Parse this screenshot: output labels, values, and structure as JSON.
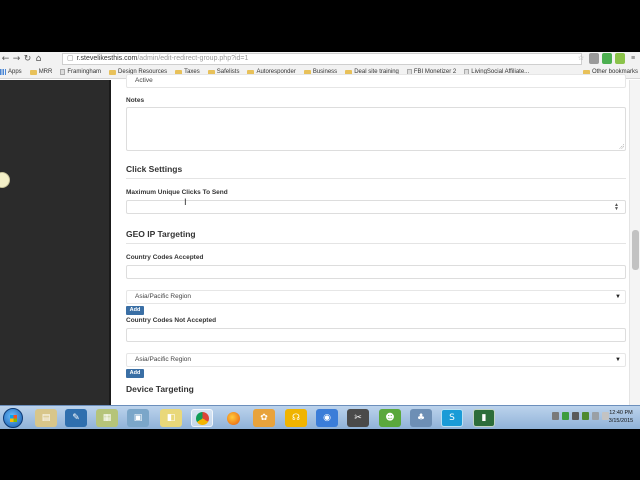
{
  "browser": {
    "url_domain": "r.stevelikesthis.com",
    "url_path": "/admin/edit-redirect-group.php?id=1",
    "bookmarks": [
      {
        "label": "Apps",
        "kind": "apps"
      },
      {
        "label": "MRR",
        "kind": "folder"
      },
      {
        "label": "Framingham",
        "kind": "page"
      },
      {
        "label": "Design Resources",
        "kind": "folder"
      },
      {
        "label": "Taxes",
        "kind": "folder"
      },
      {
        "label": "Safelists",
        "kind": "folder"
      },
      {
        "label": "Autoresponder",
        "kind": "folder"
      },
      {
        "label": "Business",
        "kind": "folder"
      },
      {
        "label": "Deal site training",
        "kind": "folder"
      },
      {
        "label": "FBI Monetizer 2",
        "kind": "page"
      },
      {
        "label": "LivingSocial Affiliate...",
        "kind": "page"
      }
    ],
    "other_bookmarks": "Other bookmarks"
  },
  "form": {
    "status_value": "Active",
    "notes_label": "Notes",
    "click_settings_heading": "Click Settings",
    "max_clicks_label": "Maximum Unique Clicks To Send",
    "geo_heading": "GEO IP Targeting",
    "accepted_label": "Country Codes Accepted",
    "accepted_select": "Asia/Pacific Region",
    "add_label": "Add",
    "not_accepted_label": "Country Codes Not Accepted",
    "not_accepted_select": "Asia/Pacific Region",
    "device_heading": "Device Targeting"
  },
  "taskbar": {
    "clock_time": "12:40 PM",
    "clock_date": "3/15/2015"
  },
  "colors": {
    "button": "#3a6fa5",
    "sidebar": "#2b2b2b",
    "taskbar": "#9fbde0"
  }
}
